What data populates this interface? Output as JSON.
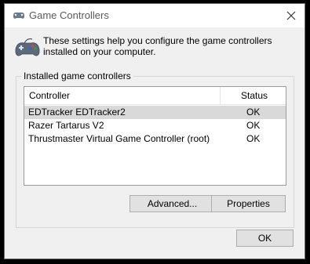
{
  "window": {
    "title": "Game Controllers",
    "header_text": "These settings help you configure the game controllers installed on your computer.",
    "icons": {
      "title": "gamepad-icon",
      "header": "gamepad-icon",
      "close": "close-icon"
    }
  },
  "group": {
    "legend": "Installed game controllers",
    "columns": {
      "controller": "Controller",
      "status": "Status"
    },
    "rows": [
      {
        "name": "EDTracker EDTracker2",
        "status": "OK",
        "selected": true
      },
      {
        "name": "Razer Tartarus V2",
        "status": "OK",
        "selected": false
      },
      {
        "name": "Thrustmaster Virtual Game Controller (root)",
        "status": "OK",
        "selected": false
      }
    ]
  },
  "buttons": {
    "advanced": "Advanced...",
    "properties": "Properties",
    "ok": "OK"
  }
}
